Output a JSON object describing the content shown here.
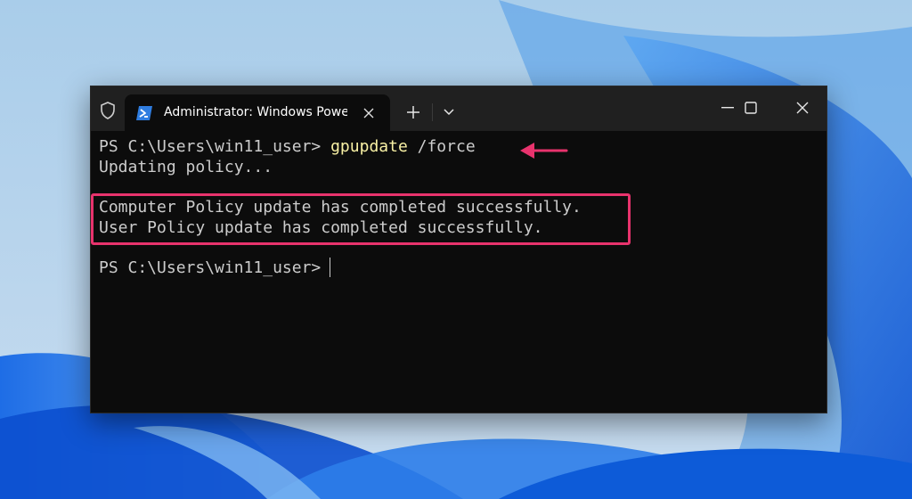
{
  "window": {
    "tab_title": "Administrator: Windows PowerShell",
    "controls": [
      "minimize",
      "maximize",
      "close"
    ]
  },
  "icons": {
    "admin": "shield-icon",
    "tab": "powershell-icon",
    "tab_close": "close-icon",
    "new_tab": "plus-icon",
    "dropdown": "chevron-down-icon"
  },
  "console": {
    "line1": {
      "prompt": "PS C:\\Users\\win11_user> ",
      "command": "gpupdate",
      "argument": " /force"
    },
    "line2": "Updating policy...",
    "line3": "Computer Policy update has completed successfully.",
    "line4": "User Policy update has completed successfully.",
    "line5": "PS C:\\Users\\win11_user>"
  },
  "colors": {
    "annotation": "#e8336d",
    "command": "#f9f1a5",
    "text": "#cccccc",
    "background": "#0c0c0c",
    "titlebar": "#202020"
  }
}
